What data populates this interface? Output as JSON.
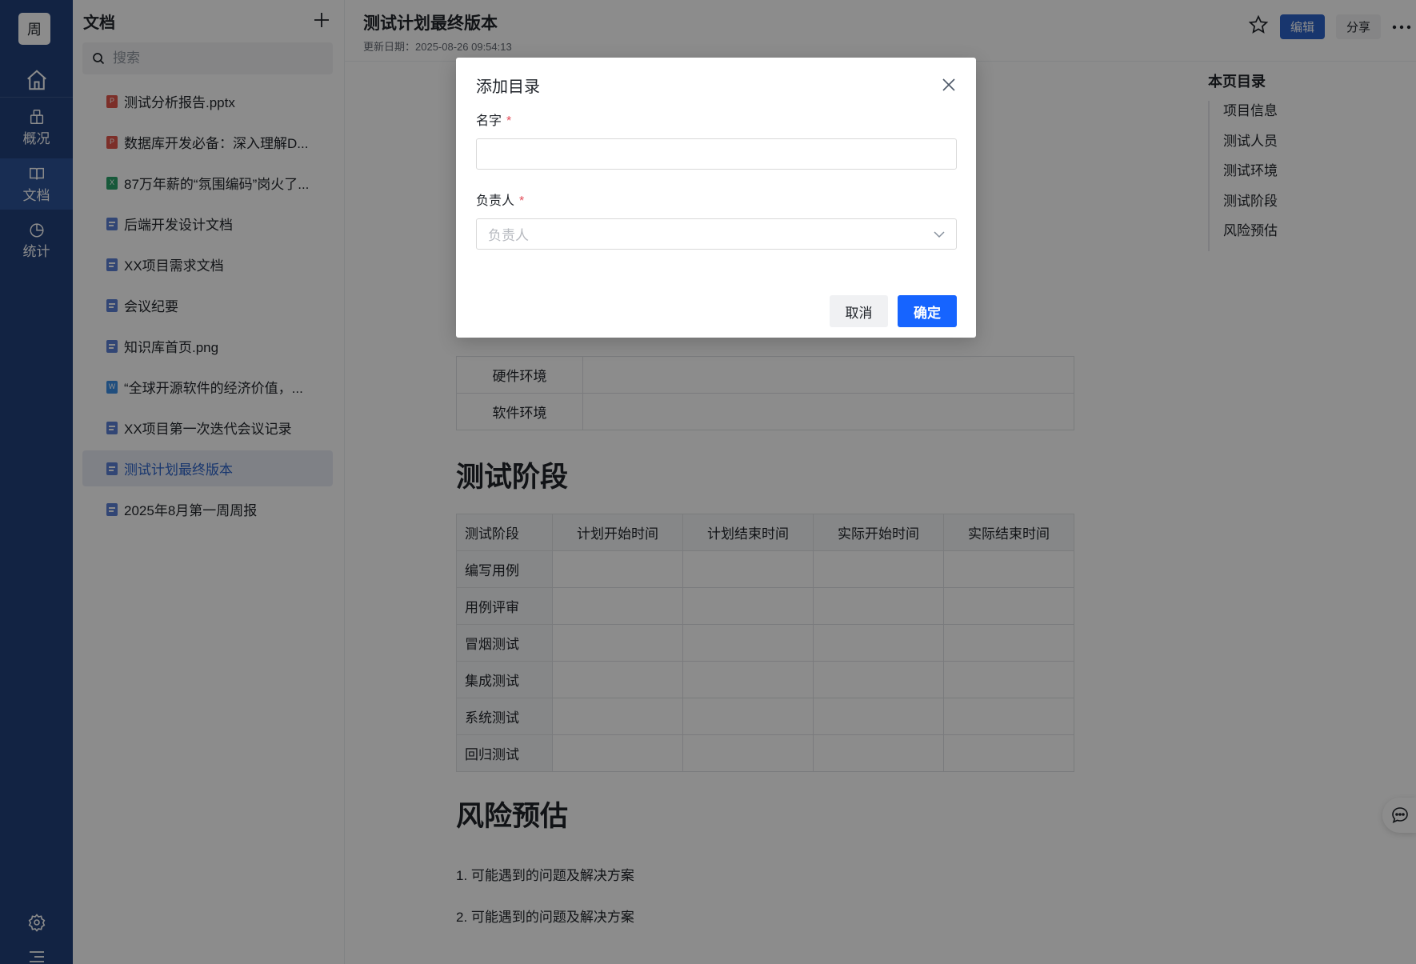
{
  "rail": {
    "avatar": "周",
    "items": [
      {
        "label": "概况"
      },
      {
        "label": "文档"
      },
      {
        "label": "统计"
      }
    ]
  },
  "sidebar": {
    "title": "文档",
    "search_placeholder": "搜索",
    "docs": [
      {
        "type": "p",
        "name": "测试分析报告.pptx"
      },
      {
        "type": "p",
        "name": "数据库开发必备：深入理解D..."
      },
      {
        "type": "x",
        "name": "87万年薪的“氛围编码”岗火了..."
      },
      {
        "type": "d",
        "name": "后端开发设计文档"
      },
      {
        "type": "d",
        "name": "XX项目需求文档"
      },
      {
        "type": "d",
        "name": "会议纪要"
      },
      {
        "type": "d",
        "name": "知识库首页.png"
      },
      {
        "type": "w",
        "name": "“全球开源软件的经济价值，..."
      },
      {
        "type": "d",
        "name": "XX项目第一次迭代会议记录"
      },
      {
        "type": "d",
        "name": "测试计划最终版本",
        "active": true
      },
      {
        "type": "d",
        "name": "2025年8月第一周周报"
      }
    ]
  },
  "document": {
    "title": "测试计划最终版本",
    "updated": "更新日期：2025-08-26 09:54:13",
    "actions": {
      "edit": "编辑",
      "share": "分享"
    },
    "env_rows": [
      {
        "label": "硬件环境"
      },
      {
        "label": "软件环境"
      }
    ],
    "phase_heading": "测试阶段",
    "phase_table": {
      "headers": [
        "测试阶段",
        "计划开始时间",
        "计划结束时间",
        "实际开始时间",
        "实际结束时间"
      ],
      "rows": [
        "编写用例",
        "用例评审",
        "冒烟测试",
        "集成测试",
        "系统测试",
        "回归测试"
      ]
    },
    "risk_heading": "风险预估",
    "risk_items": [
      "1. 可能遇到的问题及解决方案",
      "2. 可能遇到的问题及解决方案"
    ]
  },
  "toc": {
    "title": "本页目录",
    "items": [
      "项目信息",
      "测试人员",
      "测试环境",
      "测试阶段",
      "风险预估"
    ]
  },
  "modal": {
    "title": "添加目录",
    "name_label": "名字",
    "owner_label": "负责人",
    "required_mark": "*",
    "name_value": "",
    "owner_placeholder": "负责人",
    "cancel": "取消",
    "confirm": "确定"
  },
  "colors": {
    "rail": "#22407a",
    "primary": "#1664ff",
    "edit_button": "#2d63c8",
    "required": "#e34d59"
  }
}
